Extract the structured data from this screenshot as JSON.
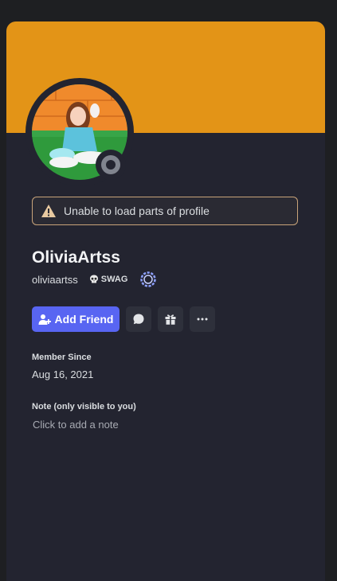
{
  "profile": {
    "display_name": "OliviaArtss",
    "username": "oliviaartss",
    "tag": "SWAG",
    "warning": "Unable to load parts of profile",
    "add_friend_label": "Add Friend",
    "member_since_label": "Member Since",
    "member_since_value": "Aug 16, 2021",
    "note_label": "Note (only visible to you)",
    "note_placeholder": "Click to add a note"
  },
  "icons": {
    "warning": "warning-triangle-icon",
    "skull": "skull-icon",
    "badge": "nitro-badge-icon",
    "add_friend": "add-friend-icon",
    "message": "message-icon",
    "gift": "gift-icon",
    "more": "more-icon"
  },
  "colors": {
    "banner": "#e39417",
    "accent": "#5865f2",
    "status": "#80848e",
    "warning_border": "#c9a47a"
  }
}
